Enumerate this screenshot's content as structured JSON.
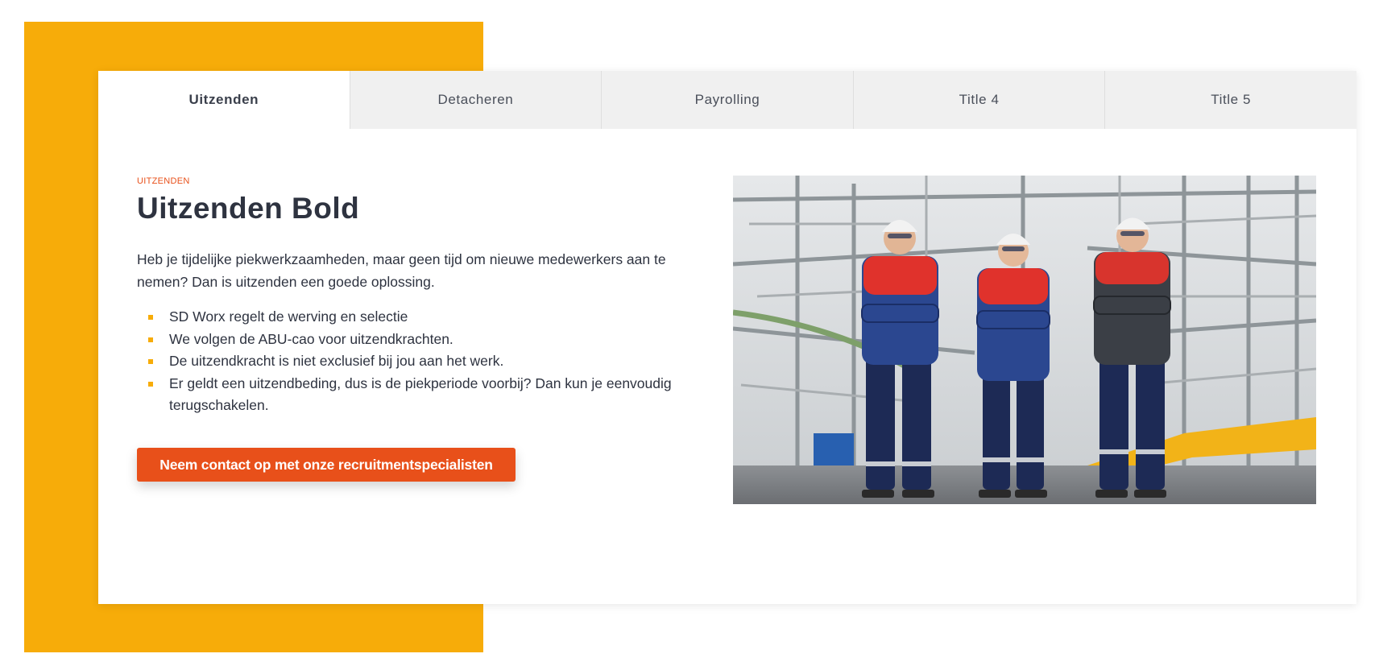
{
  "tabs": [
    {
      "label": "Uitzenden",
      "active": true
    },
    {
      "label": "Detacheren",
      "active": false
    },
    {
      "label": "Payrolling",
      "active": false
    },
    {
      "label": "Title 4",
      "active": false
    },
    {
      "label": "Title 5",
      "active": false
    }
  ],
  "panel": {
    "eyebrow": "UITZENDEN",
    "title": "Uitzenden Bold",
    "lead": "Heb je tijdelijke piekwerkzaamheden, maar geen tijd om nieuwe medewerkers aan te nemen? Dan is uitzenden een goede oplossing.",
    "bullets": [
      "SD Worx regelt de werving en selectie",
      "We volgen de ABU-cao voor uitzendkrachten.",
      "De uitzendkracht is niet exclusief bij jou aan het werk.",
      "Er geldt een uitzendbeding, dus is de piekperiode voorbij? Dan kun je eenvoudig terugschakelen."
    ],
    "cta_label": "Neem contact op met onze recruitmentspecialisten"
  },
  "colors": {
    "accent_yellow": "#f7ac09",
    "accent_orange": "#e8501a",
    "text_dark": "#2e3340",
    "tab_inactive_bg": "#f0f0f0"
  }
}
